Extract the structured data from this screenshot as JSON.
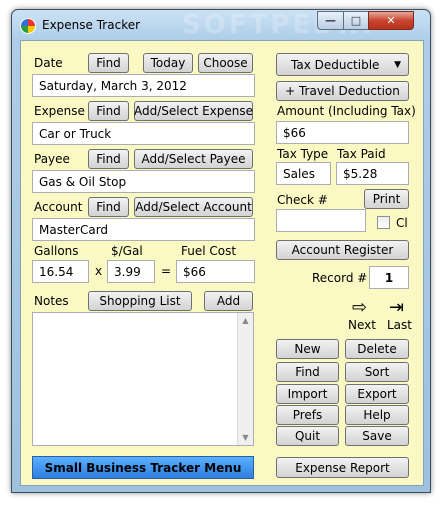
{
  "window": {
    "title": "Expense Tracker",
    "watermark": "SOFTPEDIA",
    "caption": {
      "min": "—",
      "max": "□",
      "close": "✕"
    }
  },
  "date": {
    "label": "Date",
    "find_btn": "Find",
    "today_btn": "Today",
    "choose_btn": "Choose",
    "value": "Saturday, March 3, 2012"
  },
  "expense": {
    "label": "Expense",
    "find_btn": "Find",
    "select_btn": "Add/Select Expense",
    "value": "Car or Truck"
  },
  "payee": {
    "label": "Payee",
    "find_btn": "Find",
    "select_btn": "Add/Select Payee",
    "value": "Gas & Oil Stop"
  },
  "account": {
    "label": "Account",
    "find_btn": "Find",
    "select_btn": "Add/Select Account",
    "value": "MasterCard"
  },
  "fuel": {
    "gallons_label": "Gallons",
    "gallons_value": "16.54",
    "times": "x",
    "pergal_label": "$/Gal",
    "pergal_value": "3.99",
    "equals": "=",
    "cost_label": "Fuel Cost",
    "cost_value": "$66"
  },
  "notes": {
    "label": "Notes",
    "shopping_btn": "Shopping List",
    "add_btn": "Add",
    "value": ""
  },
  "tax_deductible": {
    "value": "Tax Deductible",
    "arrow": "▼"
  },
  "travel_btn": "+ Travel Deduction",
  "amount": {
    "label": "Amount (Including Tax)",
    "value": "$66"
  },
  "tax": {
    "type_label": "Tax Type",
    "type_value": "Sales",
    "paid_label": "Tax Paid",
    "paid_value": "$5.28"
  },
  "check": {
    "label": "Check #",
    "print_btn": "Print",
    "value": "",
    "cl_label": "Cl"
  },
  "account_register_btn": "Account Register",
  "record": {
    "label": "Record #",
    "value": "1"
  },
  "nav": {
    "next_label": "Next",
    "last_label": "Last",
    "next_glyph": "⇨",
    "last_glyph": "⇥"
  },
  "actions": {
    "new": "New",
    "delete": "Delete",
    "find": "Find",
    "sort": "Sort",
    "import": "Import",
    "export": "Export",
    "prefs": "Prefs",
    "help": "Help",
    "quit": "Quit",
    "save": "Save"
  },
  "footer": {
    "menu_btn": "Small Business Tracker Menu",
    "report_btn": "Expense Report"
  }
}
